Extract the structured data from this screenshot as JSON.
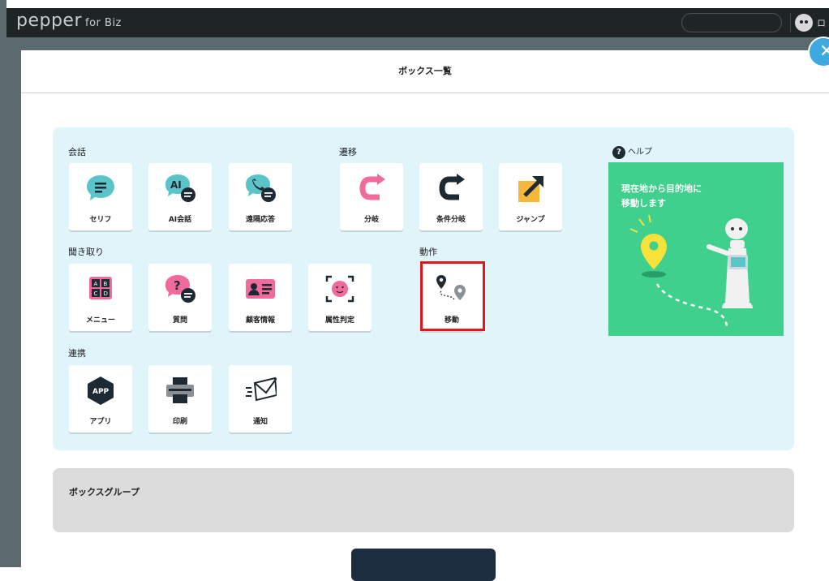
{
  "app": {
    "logo_main": "pepper",
    "logo_sub": "for Biz",
    "user_text": "ロ"
  },
  "modal": {
    "title": "ボックス一覧"
  },
  "sections": {
    "conversation": "会話",
    "transition": "遷移",
    "listening": "聞き取り",
    "action": "動作",
    "integration": "連携"
  },
  "boxes": {
    "serif": "セリフ",
    "ai_conversation": "AI会話",
    "remote_response": "遠隔応答",
    "branch": "分岐",
    "conditional_branch": "条件分岐",
    "jump": "ジャンプ",
    "menu": "メニュー",
    "question": "質問",
    "customer_info": "顧客情報",
    "attribute_judgment": "属性判定",
    "move": "移動",
    "app": "アプリ",
    "print": "印刷",
    "notification": "通知"
  },
  "help": {
    "label": "ヘルプ",
    "description_line1": "現在地から目的地に",
    "description_line2": "移動します"
  },
  "box_group": {
    "title": "ボックスグループ"
  },
  "colors": {
    "panel": "#dff5f9",
    "help_card": "#3ed08c",
    "accent_teal": "#5bc4c9",
    "accent_pink": "#f06a9b",
    "selection": "#e0161c",
    "close": "#3da9e0"
  }
}
